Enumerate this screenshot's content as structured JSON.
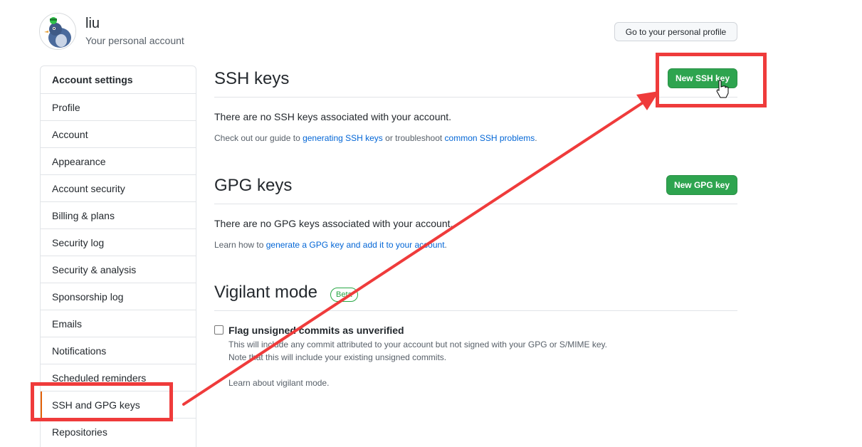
{
  "header": {
    "username": "liu",
    "subtitle": "Your personal account",
    "profile_button": "Go to your personal profile"
  },
  "sidebar": {
    "items": [
      {
        "label": "Account settings"
      },
      {
        "label": "Profile"
      },
      {
        "label": "Account"
      },
      {
        "label": "Appearance"
      },
      {
        "label": "Account security"
      },
      {
        "label": "Billing & plans"
      },
      {
        "label": "Security log"
      },
      {
        "label": "Security & analysis"
      },
      {
        "label": "Sponsorship log"
      },
      {
        "label": "Emails"
      },
      {
        "label": "Notifications"
      },
      {
        "label": "Scheduled reminders"
      },
      {
        "label": "SSH and GPG keys"
      },
      {
        "label": "Repositories"
      }
    ]
  },
  "ssh": {
    "title": "SSH keys",
    "button": "New SSH key",
    "empty_text": "There are no SSH keys associated with your account.",
    "guide_prefix": "Check out our guide to ",
    "guide_link1": "generating SSH keys",
    "guide_mid": " or troubleshoot ",
    "guide_link2": "common SSH problems",
    "guide_suffix": "."
  },
  "gpg": {
    "title": "GPG keys",
    "button": "New GPG key",
    "empty_text": "There are no GPG keys associated with your account.",
    "learn_prefix": "Learn how to ",
    "learn_link": "generate a GPG key and add it to your account",
    "learn_suffix": "."
  },
  "vigilant": {
    "title": "Vigilant mode",
    "badge": "Beta",
    "checkbox_label": "Flag unsigned commits as unverified",
    "note1": "This will include any commit attributed to your account but not signed with your GPG or S/MIME key.",
    "note2": "Note that this will include your existing unsigned commits.",
    "learn_link": "Learn about vigilant mode."
  },
  "colors": {
    "green_button": "#2ea44f",
    "link": "#0366d6",
    "annotation_red": "#ef3b3b"
  }
}
